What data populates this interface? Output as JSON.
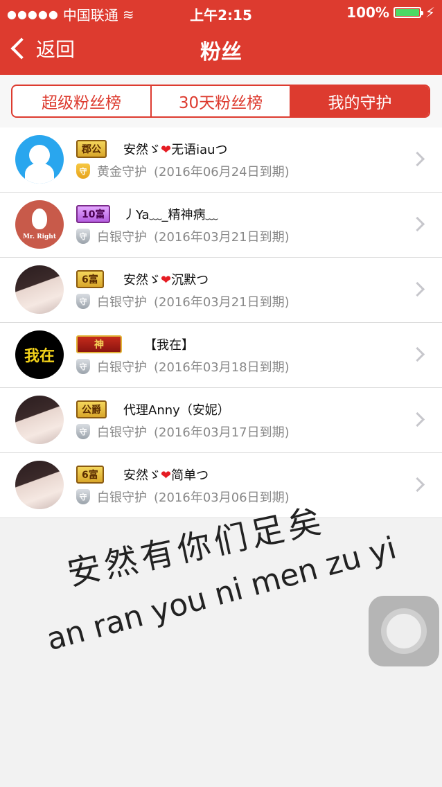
{
  "status": {
    "carrier": "中国联通",
    "time": "上午2:15",
    "battery": "100%",
    "battery_color": "#4cd964"
  },
  "nav": {
    "back_label": "返回",
    "title": "粉丝"
  },
  "tabs": [
    {
      "label": "超级粉丝榜",
      "active": false
    },
    {
      "label": "30天粉丝榜",
      "active": false
    },
    {
      "label": "我的守护",
      "active": true
    }
  ],
  "items": [
    {
      "badge": "郡公",
      "name_a": "安然ゞ",
      "name_b": "无语iauつ",
      "guard": "黄金守护",
      "expiry": "(2016年06月24日到期)"
    },
    {
      "badge": "10富",
      "name_a": "丿Ya﹏_精神病﹏",
      "name_b": "",
      "guard": "白银守护",
      "expiry": "(2016年03月21日到期)"
    },
    {
      "badge": "6富",
      "name_a": "安然ゞ",
      "name_b": "沉默つ",
      "guard": "白银守护",
      "expiry": "(2016年03月21日到期)"
    },
    {
      "badge": "神",
      "name_a": "【我在】",
      "name_b": "",
      "guard": "白银守护",
      "expiry": "(2016年03月18日到期)"
    },
    {
      "badge": "公爵",
      "name_a": "代理Anny（安妮）",
      "name_b": "",
      "guard": "白银守护",
      "expiry": "(2016年03月17日到期)"
    },
    {
      "badge": "6富",
      "name_a": "安然ゞ",
      "name_b": "简单つ",
      "guard": "白银守护",
      "expiry": "(2016年03月06日到期)"
    }
  ],
  "avatars": {
    "mr_right": "Mr. Right",
    "wo_zai": "我在"
  },
  "guard_icon_char": "守",
  "heart": "❤",
  "overlay": {
    "line1": "安然有你们足矣",
    "line2": "an ran you ni men zu yi"
  },
  "colors": {
    "brand": "#dd3b2f",
    "gold": "#e7a31b",
    "silver": "#9ba3ab"
  }
}
